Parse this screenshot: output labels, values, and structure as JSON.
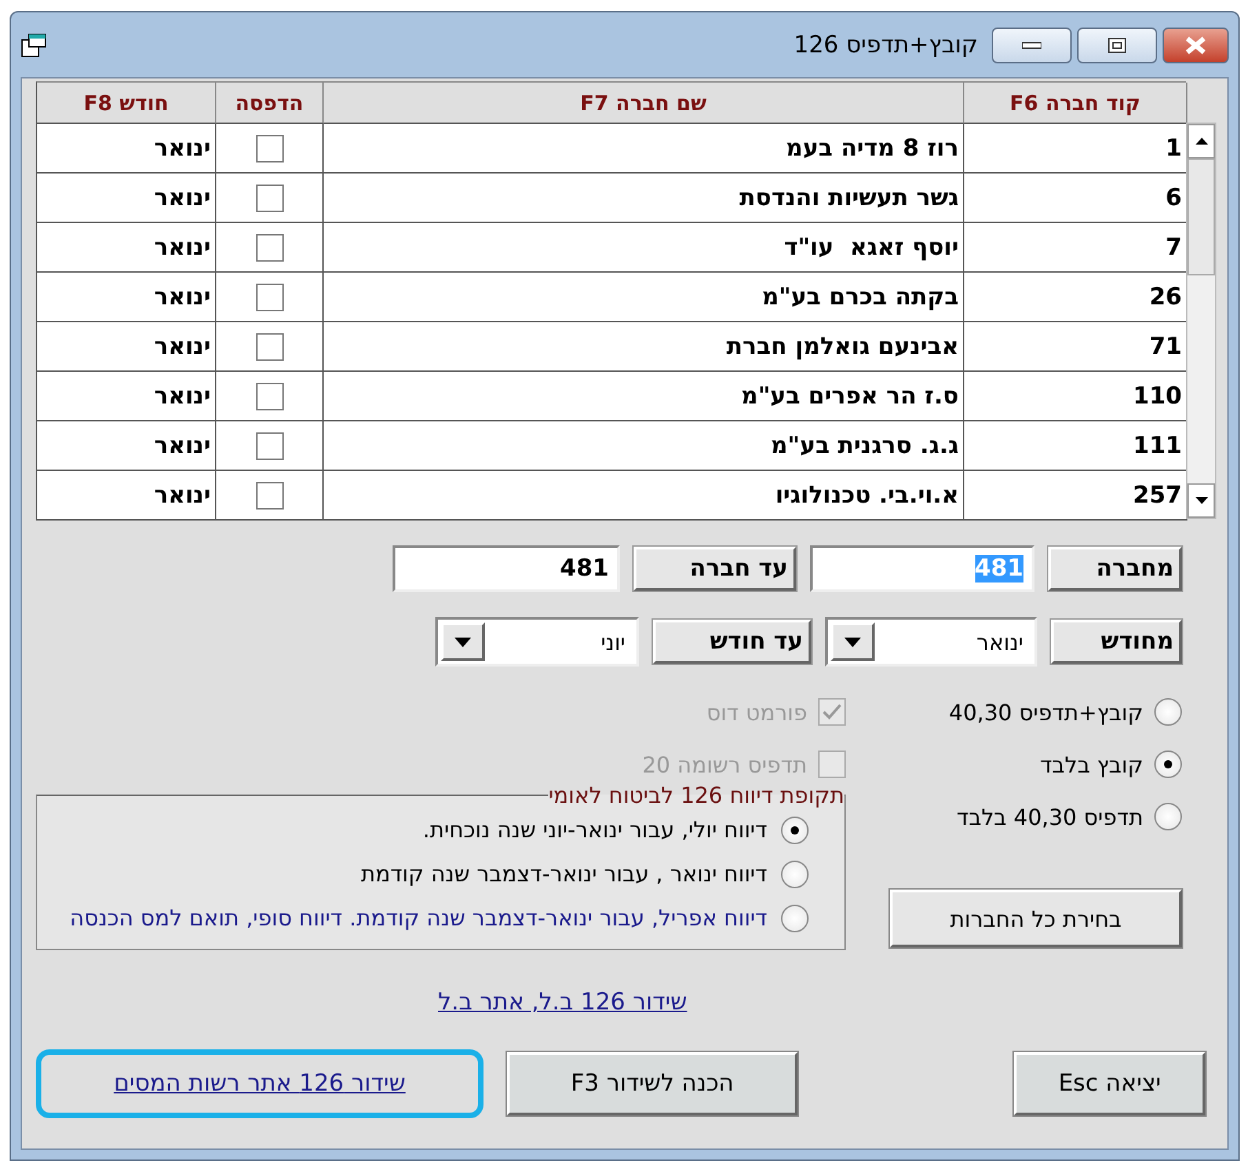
{
  "window": {
    "title": "קובץ+תדפיס 126"
  },
  "table": {
    "columns": [
      "קוד חברה F6",
      "שם חברה F7",
      "הדפסה",
      "חודש F8"
    ],
    "rows": [
      {
        "code": "1",
        "name": "רוז 8 מדיה בעמ",
        "checked": false,
        "month": "ינואר"
      },
      {
        "code": "6",
        "name": "גשר תעשיות והנדסת",
        "checked": false,
        "month": "ינואר"
      },
      {
        "code": "7",
        "name": "יוסף זאגא  עו\"ד",
        "checked": false,
        "month": "ינואר"
      },
      {
        "code": "26",
        "name": "בקתה בכרם בע\"מ",
        "checked": false,
        "month": "ינואר"
      },
      {
        "code": "71",
        "name": "אבינעם גואלמן חברת",
        "checked": false,
        "month": "ינואר"
      },
      {
        "code": "110",
        "name": "ס.ז הר אפרים בע\"מ",
        "checked": false,
        "month": "ינואר"
      },
      {
        "code": "111",
        "name": "ג.ג. סרגנית בע\"מ",
        "checked": false,
        "month": "ינואר"
      },
      {
        "code": "257",
        "name": "א.וי.בי. טכנולוגיו",
        "checked": false,
        "month": "ינואר"
      }
    ]
  },
  "company_range": [
    {
      "label": "מחברה",
      "value": "481",
      "text_selected": true
    },
    {
      "label": "עד חברה",
      "value": "481",
      "text_selected": false
    }
  ],
  "month_range": [
    {
      "label": "מחודש",
      "value": "ינואר"
    },
    {
      "label": "עד חודש",
      "value": "יוני"
    }
  ],
  "output_options": [
    {
      "label": "קובץ+תדפיס 40,30",
      "selected": false
    },
    {
      "label": "קובץ בלבד",
      "selected": true
    },
    {
      "label": "תדפיס 40,30 בלבד",
      "selected": false
    }
  ],
  "checkboxes": [
    {
      "label": "פורמט דוס",
      "checked": true,
      "disabled": true
    },
    {
      "label": "תדפיס רשומה 20",
      "checked": false,
      "disabled": true
    }
  ],
  "report_period": {
    "title": "תקופת דיווח 126 לביטוח לאומי",
    "options": [
      {
        "label": "דיווח יולי, עבור ינואר-יוני שנה נוכחית.",
        "selected": true,
        "color": "#000000"
      },
      {
        "label": "דיווח ינואר , עבור ינואר-דצמבר שנה קודמת",
        "selected": false,
        "color": "#000000"
      },
      {
        "label": "דיווח אפריל, עבור ינואר-דצמבר שנה קודמת. דיווח סופי, תואם למס הכנסה",
        "selected": false,
        "color": "#1a1a8c"
      }
    ]
  },
  "select_all_button": "בחירת כל החברות",
  "nii_link": "שידור 126 ב.ל, אתר ב.ל",
  "tax_link": {
    "label": "שידור 126 אתר רשות המסים",
    "highlighted": true
  },
  "prepare_button": "הכנה לשידור F3",
  "exit_button": "יציאה Esc"
}
